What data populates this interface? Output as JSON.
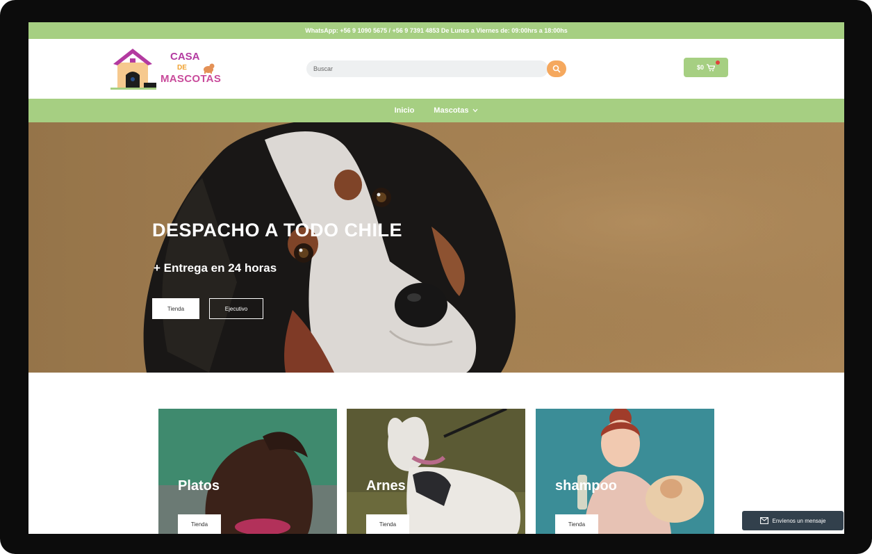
{
  "topbar": {
    "text": "WhatsApp: +56 9 1090 5675 / +56 9 7391 4853 De Lunes a Viernes de: 09:00hrs a 18:00hs"
  },
  "header": {
    "logo": {
      "line1": "CASA",
      "line2": "DE",
      "line3": "MASCOTAS"
    },
    "search": {
      "placeholder": "Buscar"
    },
    "cart": {
      "label": "$0"
    }
  },
  "nav": {
    "items": [
      {
        "label": "Inicio"
      },
      {
        "label": "Mascotas"
      }
    ]
  },
  "hero": {
    "title": "DESPACHO A TODO CHILE",
    "subtitle": "+ Entrega en 24 horas",
    "primary_button": "Tienda",
    "secondary_button": "Ejecutivo"
  },
  "categories": [
    {
      "title": "Platos",
      "button": "Tienda"
    },
    {
      "title": "Arnes",
      "button": "Tienda"
    },
    {
      "title": "shampoo",
      "button": "Tienda"
    }
  ],
  "chat": {
    "label": "Envíenos un mensaje"
  },
  "colors": {
    "brand_green": "#a6cf82",
    "search_accent": "#f5a85e",
    "logo_magenta": "#b33aa0",
    "hero_tan": "#b18a58",
    "chat_bg": "#32404c"
  },
  "icons": [
    "house-logo-icon",
    "search-icon",
    "cart-icon",
    "chevron-down-icon",
    "message-icon"
  ]
}
